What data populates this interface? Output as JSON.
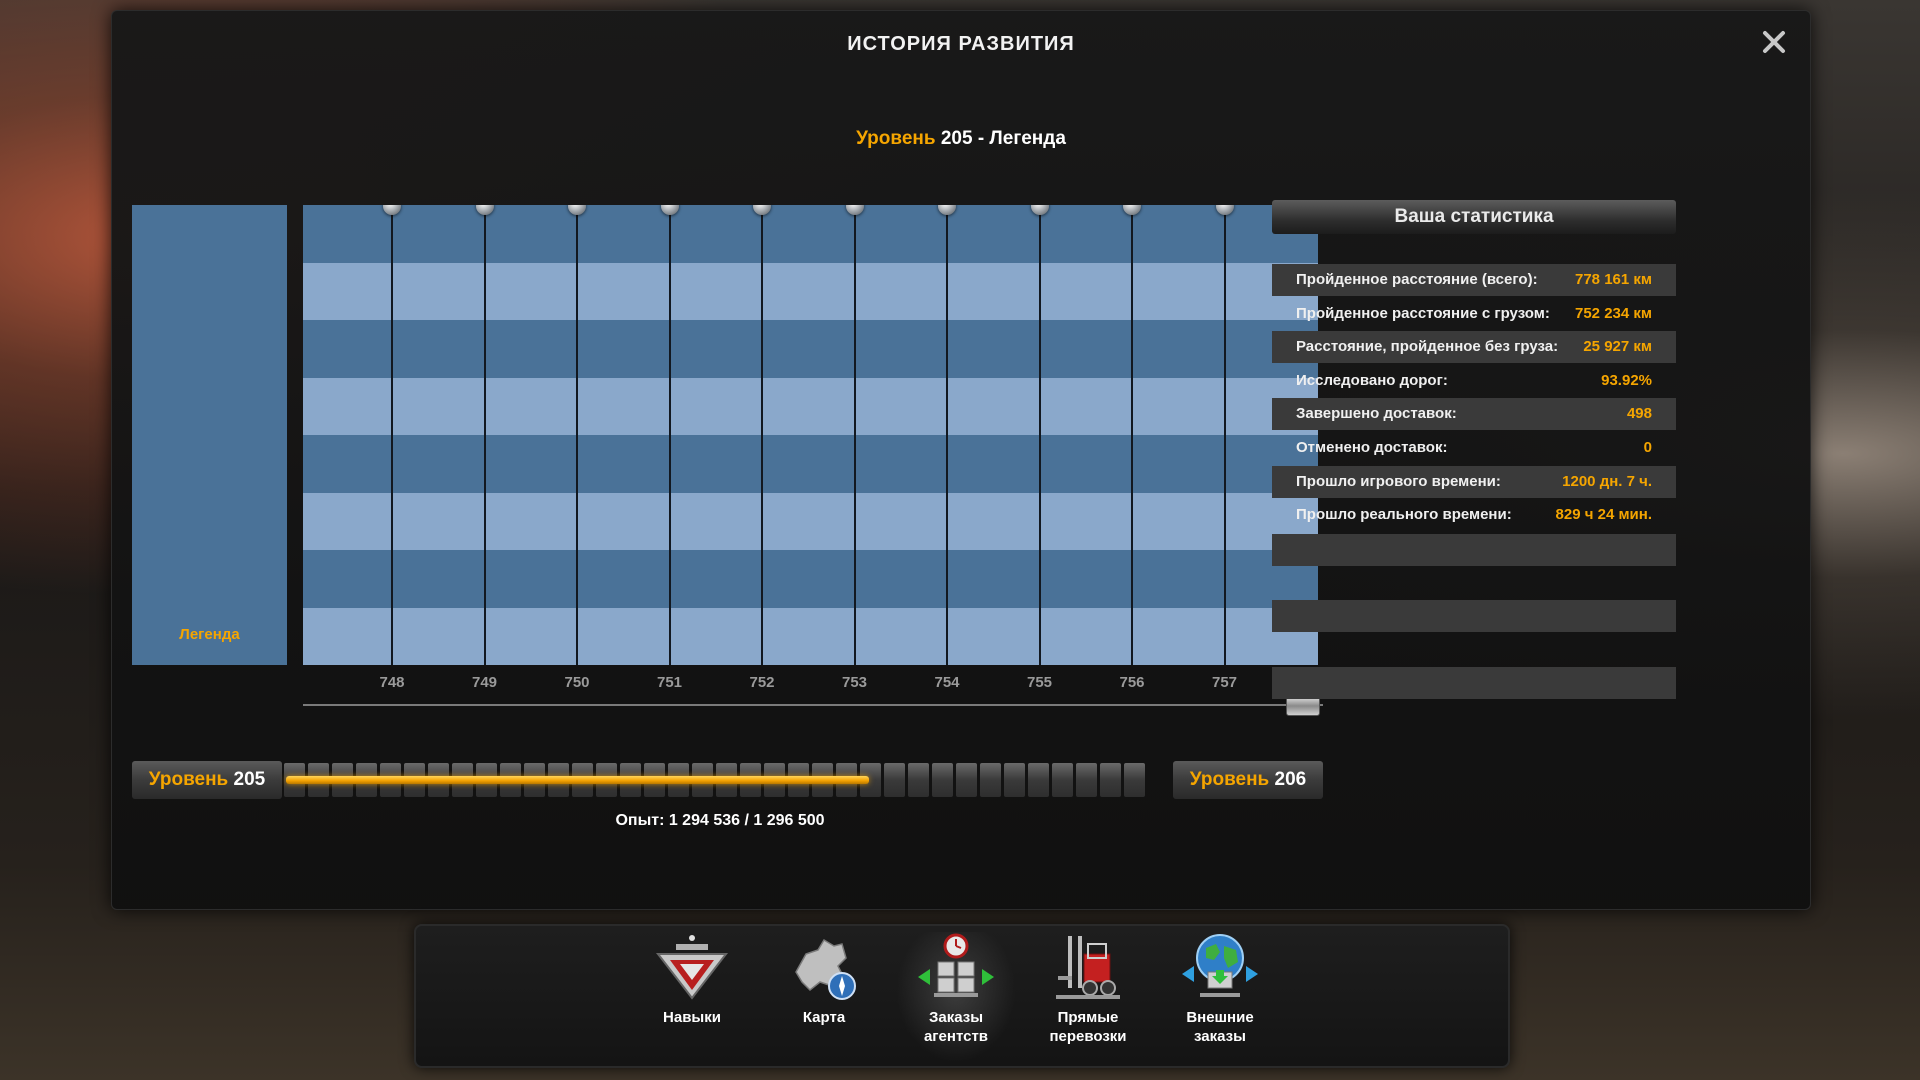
{
  "window": {
    "title": "ИСТОРИЯ РАЗВИТИЯ",
    "level_word": "Уровень",
    "level_number": "205",
    "level_rank": "- Легенда"
  },
  "legend": {
    "label": "Легенда"
  },
  "chart_data": {
    "type": "table",
    "columns": [
      "748",
      "749",
      "750",
      "751",
      "752",
      "753",
      "754",
      "755",
      "756",
      "757"
    ],
    "row_count": 8,
    "colors": {
      "dark": "#4a7298",
      "light": "#8aa8cb"
    }
  },
  "xp": {
    "left_word": "Уровень",
    "left_level": "205",
    "right_word": "Уровень",
    "right_level": "206",
    "text": "Опыт: 1 294 536 / 1 296 500",
    "progress": 0.658
  },
  "stats": {
    "title": "Ваша статистика",
    "rows": [
      {
        "label": "Пройденное расстояние (всего):",
        "value": "778 161 км"
      },
      {
        "label": "Пройденное расстояние с грузом:",
        "value": "752 234 км"
      },
      {
        "label": "Расстояние, пройденное без груза:",
        "value": "25 927 км"
      },
      {
        "label": "Исследовано дорог:",
        "value": "93.92%"
      },
      {
        "label": "Завершено доставок:",
        "value": "498"
      },
      {
        "label": "Отменено доставок:",
        "value": "0"
      },
      {
        "label": "Прошло игрового времени:",
        "value": "1200 дн. 7 ч."
      },
      {
        "label": "Прошло реального времени:",
        "value": "829 ч 24 мин."
      }
    ]
  },
  "toolbar": {
    "items": [
      {
        "line1": "Навыки",
        "line2": "",
        "icon": "skills-icon"
      },
      {
        "line1": "Карта",
        "line2": "",
        "icon": "map-icon"
      },
      {
        "line1": "Заказы",
        "line2": "агентств",
        "icon": "agency-orders-icon"
      },
      {
        "line1": "Прямые",
        "line2": "перевозки",
        "icon": "forklift-icon"
      },
      {
        "line1": "Внешние",
        "line2": "заказы",
        "icon": "globe-icon"
      }
    ]
  },
  "colors": {
    "accent": "#f5a500"
  }
}
